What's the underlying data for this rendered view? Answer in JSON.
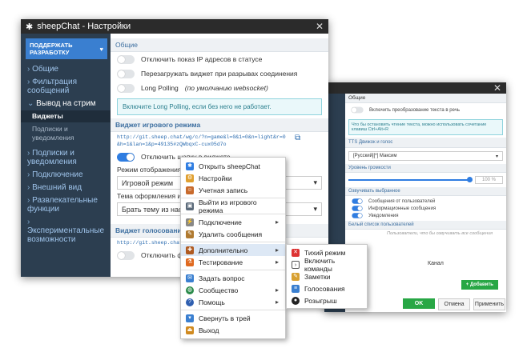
{
  "win1": {
    "title": "sheepChat - Настройки",
    "close": "✕"
  },
  "sidebar": {
    "donate": "ПОДДЕРЖАТЬ РАЗРАБОТКУ",
    "items": [
      "Общие",
      "Фильтрация сообщений",
      "Вывод на стрим",
      "Виджеты",
      "Подписки и уведомления",
      "Подписки и уведомления",
      "Подключение",
      "Внешний вид",
      "Развлекательные функции",
      "Экспериментальные возможности"
    ]
  },
  "general": {
    "title": "Общие",
    "opt1": "Отключить показ IP адресов в статусе",
    "opt2": "Перезагружать виджет при разрывах соединения",
    "opt3": "Long Polling",
    "opt3_note": "(по умолчанию websocket)",
    "info": "Включите Long Polling, если без него не работает."
  },
  "game_widget": {
    "title": "Виджет игрового режима",
    "url": "http://git.sheep.chat/wg/c/?n=game&l=0&1=0&n=light&r=0&h=1&lan=1&p=49135#zQWbqxC-cux05d7o",
    "hide_header": "Отключить шапку в виджете",
    "mode_label": "Режим отображения",
    "mode_value": "Игровой режим",
    "theme_label": "Тема оформления игр",
    "theme_value": "Брать тему из наст"
  },
  "voice_widget": {
    "title": "Виджет голосования",
    "url": "http://git.sheep.chat/wg/v/?...bqxC-cux05d7o",
    "disable": "Отключить ф"
  },
  "context_menu": {
    "items": [
      "Открыть sheepChat",
      "Настройки",
      "Учетная запись",
      "Выйти из игрового режима",
      "Подключение",
      "Удалить сообщения",
      "Дополнительно",
      "Тестирование",
      "Задать вопрос",
      "Сообщество",
      "Помощь",
      "Свернуть в трей",
      "Выход"
    ]
  },
  "submenu": {
    "items": [
      "Тихий режим",
      "Включить команды",
      "Заметки",
      "Голосования",
      "Розыгрыш"
    ]
  },
  "win2": {
    "close": "✕",
    "general": "Общие",
    "opt1": "Включить преобразование текста в речь",
    "info": "Что бы остановить чтение текста, можно использовать сочетание клавиш Ctrl+Alt+R",
    "tts_label": "TTS Движок и голос",
    "tts_value": "[Русский][*] Максим",
    "vol_label": "Уровень громкости",
    "vol_value": "100 %",
    "voice_label": "Озвучивать выбранное",
    "voice_opts": [
      "Сообщения от пользователей",
      "Информационные сообщения",
      "Уведомления"
    ],
    "whitelist": "Белый список пользователей",
    "whitelist_hint": "Пользователи, что бы озвучивать все сообщения",
    "col_channel": "Канал",
    "add_btn": "Добавить",
    "ok": "OK",
    "cancel": "Отмена",
    "apply": "Применить"
  }
}
